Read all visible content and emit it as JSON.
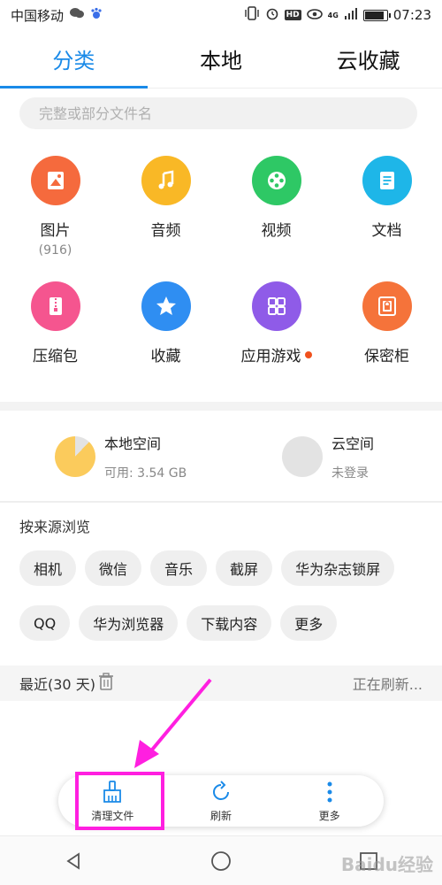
{
  "status_bar": {
    "carrier": "中国移动",
    "time": "07:23",
    "hd": "HD",
    "net": "4G",
    "battery_level": 0.9
  },
  "tabs": [
    {
      "label": "分类",
      "active": true
    },
    {
      "label": "本地",
      "active": false
    },
    {
      "label": "云收藏",
      "active": false
    }
  ],
  "search": {
    "placeholder": "完整或部分文件名"
  },
  "categories": [
    {
      "label": "图片",
      "sub": "(916)",
      "icon": "image-icon",
      "color": "#f56a3d"
    },
    {
      "label": "音频",
      "sub": "",
      "icon": "music-icon",
      "color": "#f9b826"
    },
    {
      "label": "视频",
      "sub": "",
      "icon": "video-icon",
      "color": "#2ec865"
    },
    {
      "label": "文档",
      "sub": "",
      "icon": "document-icon",
      "color": "#1eb6e8"
    },
    {
      "label": "压缩包",
      "sub": "",
      "icon": "archive-icon",
      "color": "#f5558f"
    },
    {
      "label": "收藏",
      "sub": "",
      "icon": "star-icon",
      "color": "#2f8ef2"
    },
    {
      "label": "应用游戏",
      "sub": "",
      "icon": "apps-icon",
      "color": "#8f5be8",
      "badge": true
    },
    {
      "label": "保密柜",
      "sub": "",
      "icon": "safe-icon",
      "color": "#f5733a"
    }
  ],
  "storage": {
    "local": {
      "title": "本地空间",
      "sub": "可用: 3.54 GB",
      "used_fraction": 0.88,
      "color": "#fbcb5c"
    },
    "cloud": {
      "title": "云空间",
      "sub": "未登录"
    }
  },
  "sources": {
    "title": "按来源浏览",
    "chips_row1": [
      "相机",
      "微信",
      "音乐",
      "截屏",
      "华为杂志锁屏"
    ],
    "chips_row2": [
      "QQ",
      "华为浏览器",
      "下载内容",
      "更多"
    ]
  },
  "recent": {
    "label": "最近(30 天)",
    "status": "正在刷新..."
  },
  "toolbar": {
    "clean_label": "清理文件",
    "refresh_label": "刷新",
    "more_label": "更多"
  },
  "colors": {
    "accent": "#1a8ae8",
    "highlight": "#ff1fe0"
  },
  "watermark": "Baidu经验"
}
